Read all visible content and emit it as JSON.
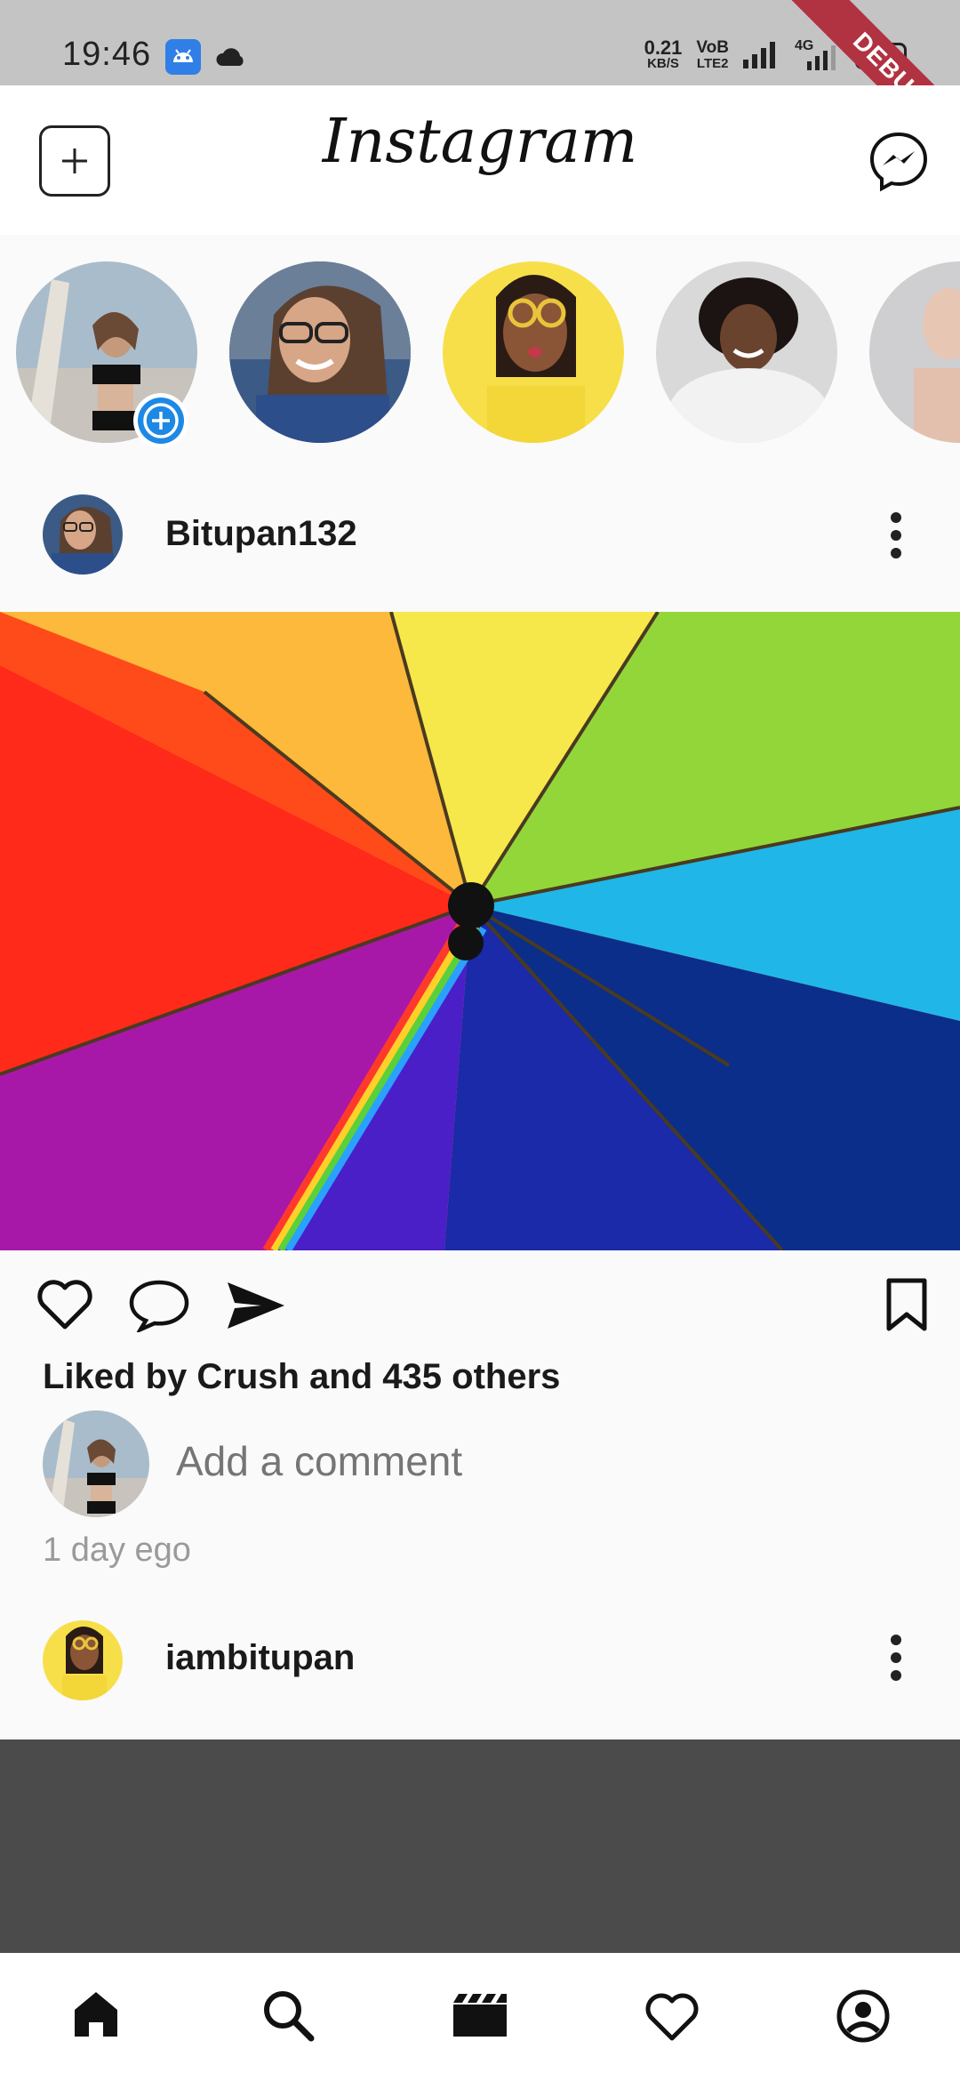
{
  "status_bar": {
    "time": "19:46",
    "net_speed_value": "0.21",
    "net_speed_unit": "KB/S",
    "volte_top": "VoB",
    "volte_bottom": "LTE2",
    "network_type": "4G",
    "battery": "100",
    "debug_label": "DEBUG"
  },
  "app_bar": {
    "logo": "Instagram",
    "new_post_icon": "plus-square-icon",
    "messenger_icon": "messenger-icon"
  },
  "stories": [
    {
      "name": "my-story",
      "has_add": true
    },
    {
      "name": "story-2"
    },
    {
      "name": "story-3"
    },
    {
      "name": "story-4"
    },
    {
      "name": "story-5"
    }
  ],
  "posts": [
    {
      "username": "Bitupan132",
      "likes_text": "Liked by Crush and 435 others",
      "comment_placeholder": "Add a comment",
      "time_ago": "1 day ego"
    },
    {
      "username": "iambitupan"
    }
  ],
  "bottom_nav": [
    "home-icon",
    "search-icon",
    "reels-icon",
    "heart-icon",
    "profile-icon"
  ],
  "colors": {
    "accent_blue": "#1e88e5",
    "text_dark": "#262626",
    "muted": "#8c8c8c"
  }
}
